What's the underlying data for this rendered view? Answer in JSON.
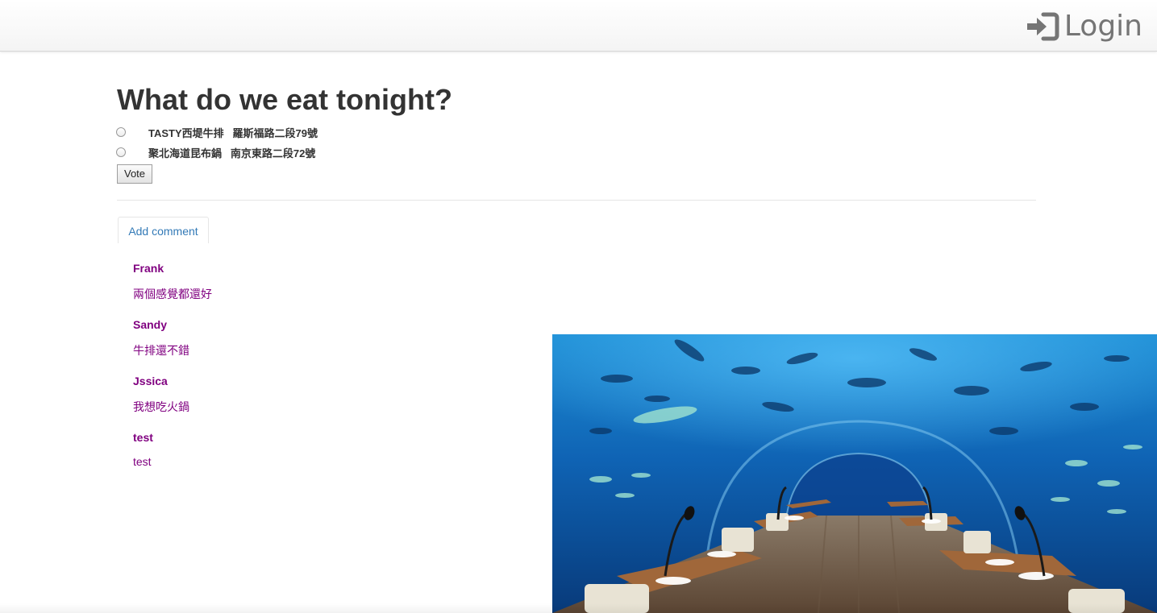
{
  "header": {
    "login_label": "Login",
    "login_icon": "sign-in-icon",
    "icon_color": "#757575"
  },
  "poll": {
    "title": "What do we eat tonight?",
    "options": [
      {
        "label": "TASTY西堤牛排   羅斯福路二段79號"
      },
      {
        "label": "聚北海道昆布鍋   南京東路二段72號"
      }
    ],
    "vote_label": "Vote"
  },
  "comments": {
    "tab_label": "Add comment",
    "items": [
      {
        "name": "Frank",
        "text": "兩個感覺都還好"
      },
      {
        "name": "Sandy",
        "text": "牛排還不錯"
      },
      {
        "name": "Jssica",
        "text": "我想吃火鍋"
      },
      {
        "name": "test",
        "text": "test"
      }
    ]
  },
  "colors": {
    "comment_color": "#800080",
    "link_color": "#337ab7"
  }
}
